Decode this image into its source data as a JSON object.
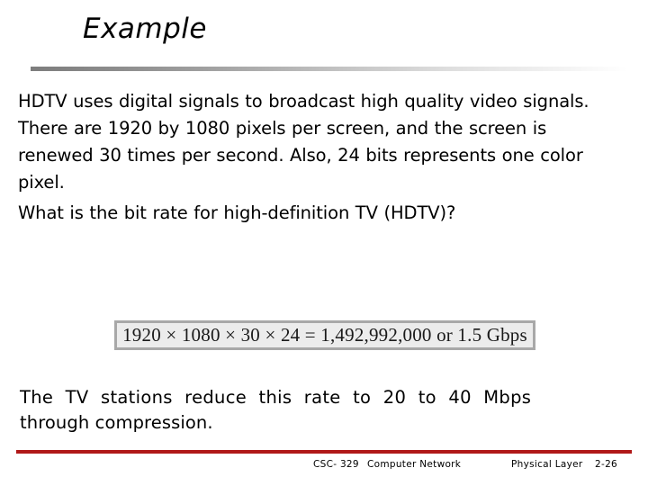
{
  "slide": {
    "title": "Example",
    "body": {
      "paragraph_1": "HDTV uses digital signals to broadcast high quality video signals. There are 1920 by 1080 pixels per screen, and the screen is renewed 30 times per second. Also, 24 bits represents one color pixel.",
      "paragraph_2": "What is the bit rate for high-definition TV (HDTV)?"
    },
    "formula": {
      "text": "1920 × 1080 × 30 × 24 = 1,492,992,000 or 1.5 Gbps",
      "border_color": "#a8a8a8",
      "fill_color": "#ececec"
    },
    "closing": {
      "line_1": "The TV stations reduce this rate to 20 to 40 Mbps",
      "line_2": "through compression."
    },
    "footer": {
      "course_code": "CSC- 329",
      "course_name": "Computer Network",
      "chapter_title": "Physical Layer",
      "page_number": "2-26",
      "rule_color": "#b01818"
    },
    "title_rule_color_start": "#7d7d7d",
    "title_rule_color_end": "#ffffff"
  }
}
